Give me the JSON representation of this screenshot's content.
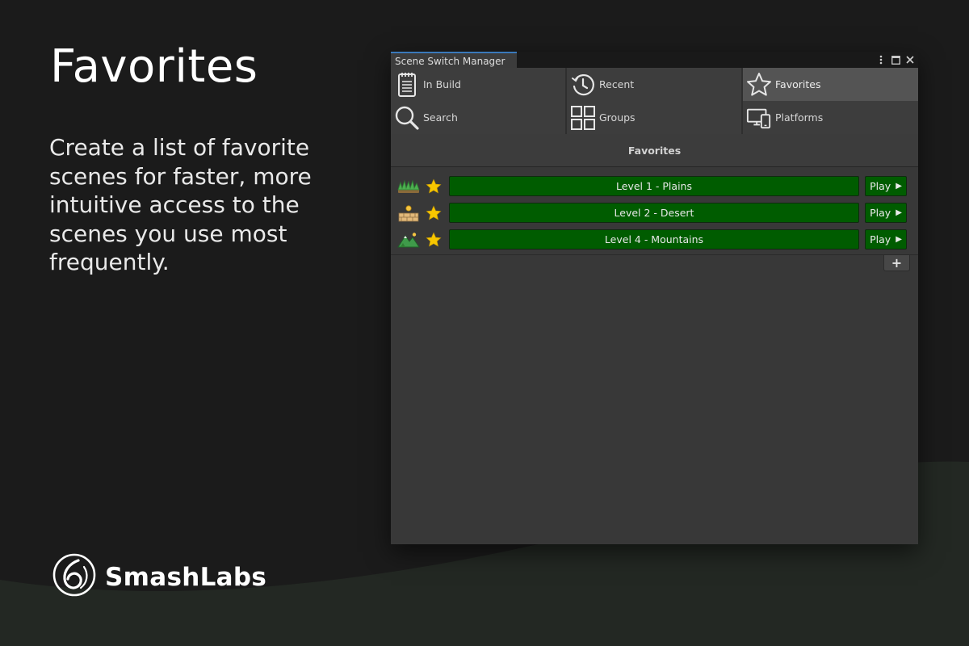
{
  "colors": {
    "page_bg": "#1b1b1b",
    "wave": "#232823",
    "window_bg": "#383838",
    "scene_button": "#005c00",
    "tab_active": "#545454",
    "star": "#f7c600",
    "accent": "#3a79bb"
  },
  "promo": {
    "title": "Favorites",
    "description": "Create a list of favorite scenes for faster, more intuitive access to the scenes you use most frequently."
  },
  "brand": {
    "name": "SmashLabs",
    "icon": "smashlabs-logo-icon"
  },
  "window": {
    "title": "Scene Switch Manager",
    "controls": [
      {
        "name": "kebab-menu-icon"
      },
      {
        "name": "maximize-icon"
      },
      {
        "name": "close-icon"
      }
    ]
  },
  "tabs": [
    {
      "label": "In Build",
      "icon": "notepad-icon",
      "active": false
    },
    {
      "label": "Recent",
      "icon": "history-icon",
      "active": false
    },
    {
      "label": "Favorites",
      "icon": "star-outline-icon",
      "active": true
    },
    {
      "label": "Search",
      "icon": "search-icon",
      "active": false
    },
    {
      "label": "Groups",
      "icon": "grid-icon",
      "active": false
    },
    {
      "label": "Platforms",
      "icon": "devices-icon",
      "active": false
    }
  ],
  "section": {
    "header": "Favorites"
  },
  "favorites": [
    {
      "scene_icon": "plains-icon",
      "scene": "Level 1 - Plains",
      "play": "Play"
    },
    {
      "scene_icon": "desert-icon",
      "scene": "Level 2 - Desert",
      "play": "Play"
    },
    {
      "scene_icon": "mountains-icon",
      "scene": "Level 4 - Mountains",
      "play": "Play"
    }
  ],
  "add_button": {
    "label": "+"
  }
}
